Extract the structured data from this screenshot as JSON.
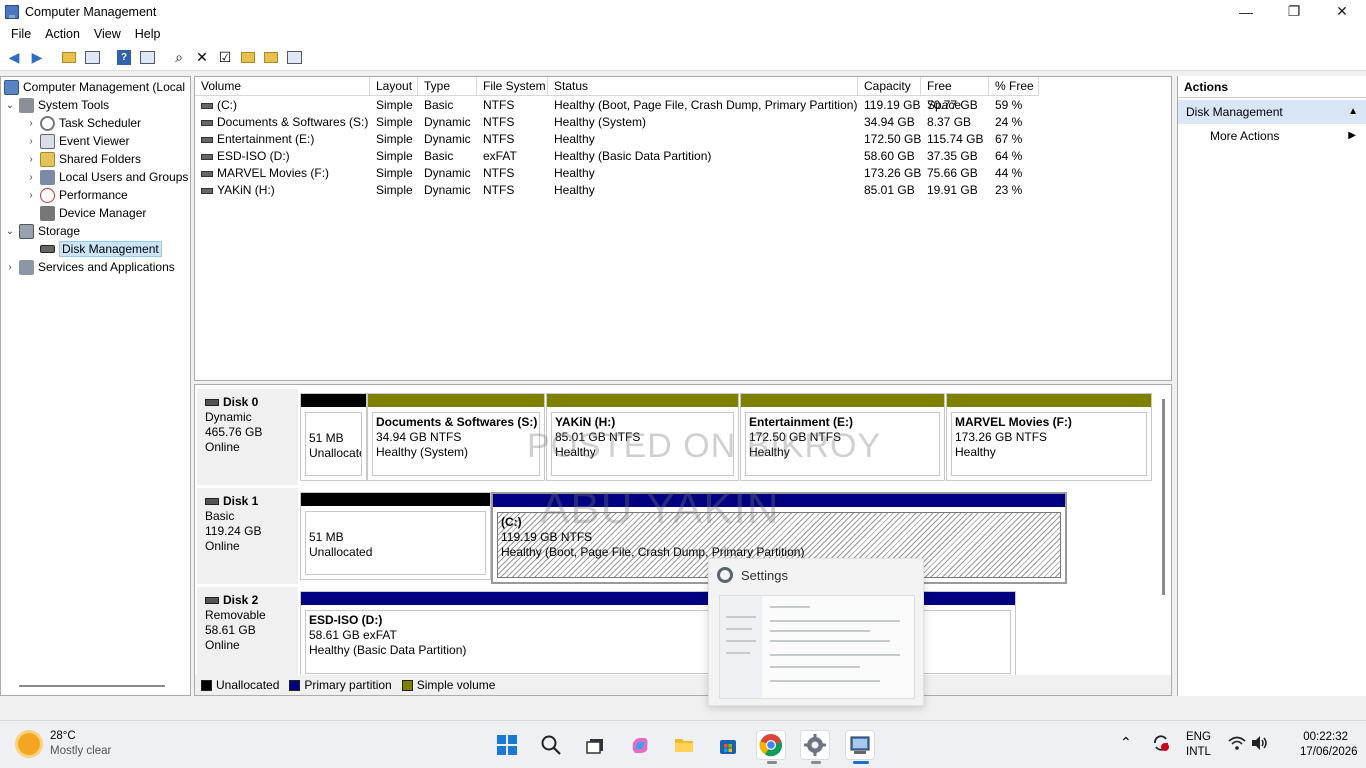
{
  "window": {
    "title": "Computer Management"
  },
  "menu": [
    "File",
    "Action",
    "View",
    "Help"
  ],
  "tree": {
    "root": "Computer Management (Local",
    "system_tools": "System Tools",
    "task_scheduler": "Task Scheduler",
    "event_viewer": "Event Viewer",
    "shared_folders": "Shared Folders",
    "local_users": "Local Users and Groups",
    "performance": "Performance",
    "device_manager": "Device Manager",
    "storage": "Storage",
    "disk_management": "Disk Management",
    "services": "Services and Applications"
  },
  "columns": [
    "Volume",
    "Layout",
    "Type",
    "File System",
    "Status",
    "Capacity",
    "Free Space",
    "% Free"
  ],
  "volumes": [
    {
      "name": "(C:)",
      "layout": "Simple",
      "type": "Basic",
      "fs": "NTFS",
      "status": "Healthy (Boot, Page File, Crash Dump, Primary Partition)",
      "capacity": "119.19 GB",
      "free": "70.77 GB",
      "pct": "59 %"
    },
    {
      "name": "Documents & Softwares  (S:)",
      "layout": "Simple",
      "type": "Dynamic",
      "fs": "NTFS",
      "status": "Healthy (System)",
      "capacity": "34.94 GB",
      "free": "8.37 GB",
      "pct": "24 %"
    },
    {
      "name": "Entertainment (E:)",
      "layout": "Simple",
      "type": "Dynamic",
      "fs": "NTFS",
      "status": "Healthy",
      "capacity": "172.50 GB",
      "free": "115.74 GB",
      "pct": "67 %"
    },
    {
      "name": "ESD-ISO (D:)",
      "layout": "Simple",
      "type": "Basic",
      "fs": "exFAT",
      "status": "Healthy (Basic Data Partition)",
      "capacity": "58.60 GB",
      "free": "37.35 GB",
      "pct": "64 %"
    },
    {
      "name": "MARVEL Movies (F:)",
      "layout": "Simple",
      "type": "Dynamic",
      "fs": "NTFS",
      "status": "Healthy",
      "capacity": "173.26 GB",
      "free": "75.66 GB",
      "pct": "44 %"
    },
    {
      "name": "YAKiN (H:)",
      "layout": "Simple",
      "type": "Dynamic",
      "fs": "NTFS",
      "status": "Healthy",
      "capacity": "85.01 GB",
      "free": "19.91 GB",
      "pct": "23 %"
    }
  ],
  "disks": {
    "d0": {
      "name": "Disk 0",
      "type": "Dynamic",
      "size": "465.76 GB",
      "state": "Online"
    },
    "d1": {
      "name": "Disk 1",
      "type": "Basic",
      "size": "119.24 GB",
      "state": "Online"
    },
    "d2": {
      "name": "Disk 2",
      "type": "Removable",
      "size": "58.61 GB",
      "state": "Online"
    }
  },
  "parts": {
    "d0_un": {
      "size": "51 MB",
      "status": "Unallocated"
    },
    "d0_s": {
      "title": "Documents & Softwares  (S:)",
      "size": "34.94 GB NTFS",
      "status": "Healthy (System)"
    },
    "d0_h": {
      "title": "YAKiN  (H:)",
      "size": "85.01 GB NTFS",
      "status": "Healthy"
    },
    "d0_e": {
      "title": "Entertainment  (E:)",
      "size": "172.50 GB NTFS",
      "status": "Healthy"
    },
    "d0_f": {
      "title": "MARVEL Movies  (F:)",
      "size": "173.26 GB NTFS",
      "status": "Healthy"
    },
    "d1_un": {
      "size": "51 MB",
      "status": "Unallocated"
    },
    "d1_c": {
      "title": "(C:)",
      "size": "119.19 GB NTFS",
      "status": "Healthy (Boot, Page File, Crash Dump, Primary Partition)"
    },
    "d2_d": {
      "title": "ESD-ISO  (D:)",
      "size": "58.61 GB exFAT",
      "status": "Healthy (Basic Data Partition)"
    }
  },
  "legend": {
    "unalloc": "Unallocated",
    "primary": "Primary partition",
    "simple": "Simple volume"
  },
  "colors": {
    "unallocated": "#000000",
    "primary": "#000080",
    "simple": "#808000"
  },
  "watermark": {
    "line1": "POSTED ON BIKROY",
    "line2": "ABU YAKIN"
  },
  "actions": {
    "header": "Actions",
    "section": "Disk Management",
    "more": "More Actions"
  },
  "settings_popup": {
    "title": "Settings"
  },
  "taskbar": {
    "temp": "28°C",
    "condition": "Mostly clear",
    "lang1": "ENG",
    "lang2": "INTL",
    "time": "00:22:32",
    "date": "17/06/2026"
  }
}
